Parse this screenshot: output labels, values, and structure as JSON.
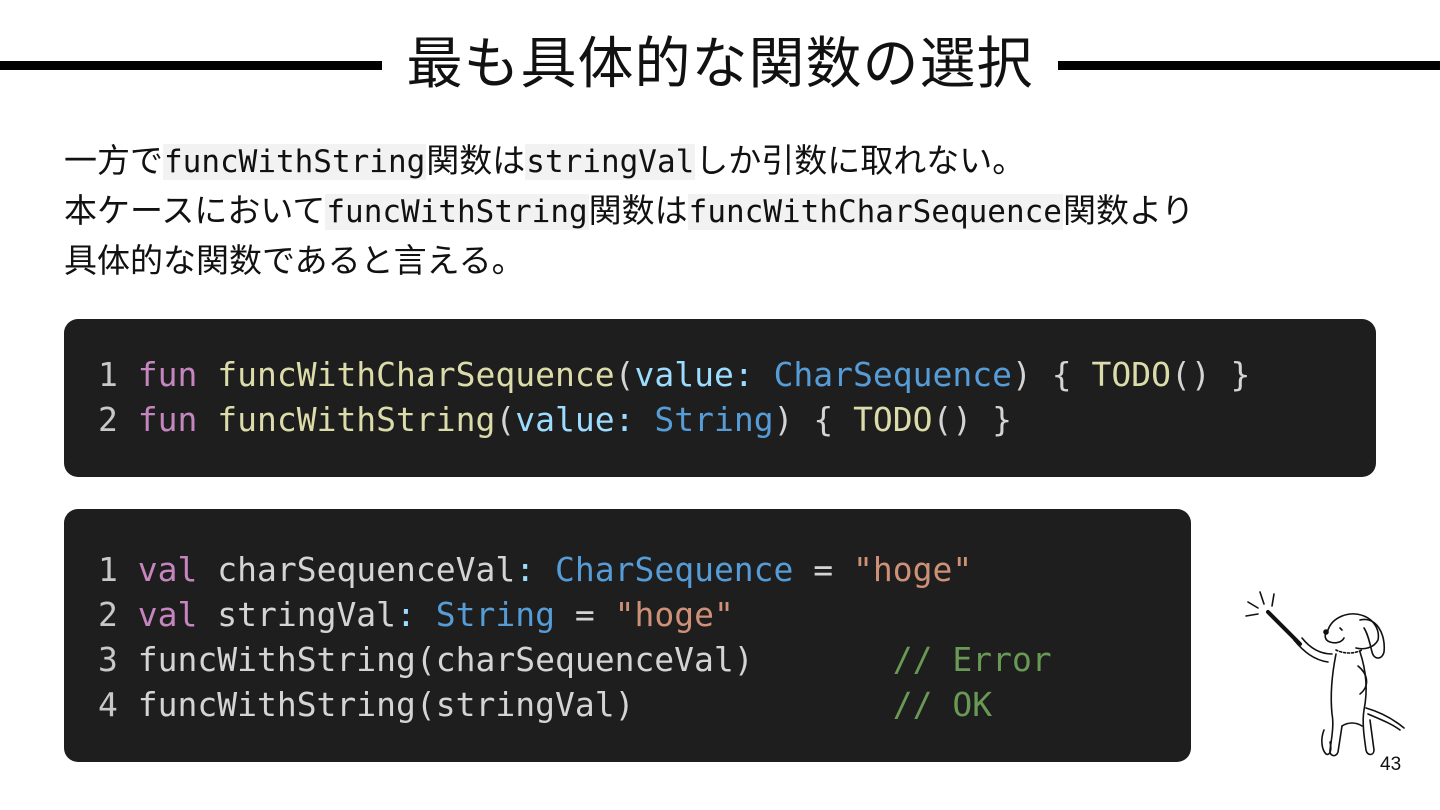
{
  "slide": {
    "title": "最も具体的な関数の選択",
    "page_number": "43"
  },
  "body": {
    "line1": {
      "t1": "一方で",
      "c1": "funcWithString",
      "t2": "関数は",
      "c2": "stringVal",
      "t3": "しか引数に取れない。"
    },
    "line2": {
      "t1": "本ケースにおいて",
      "c1": "funcWithString",
      "t2": "関数は",
      "c2": "funcWithCharSequence",
      "t3": "関数より"
    },
    "line3": {
      "t1": "具体的な関数であると言える。"
    }
  },
  "code1": {
    "lines": [
      {
        "num": "1",
        "kw": "fun",
        "fn": "funcWithCharSequence",
        "open": "(",
        "param": "value",
        "colon": ":",
        "type": "CharSequence",
        "rest": ") { ",
        "todo": "TODO",
        "end": "() }"
      },
      {
        "num": "2",
        "kw": "fun",
        "fn": "funcWithString",
        "open": "(",
        "param": "value",
        "colon": ":",
        "type": "String",
        "rest": ") { ",
        "todo": "TODO",
        "end": "() }"
      }
    ]
  },
  "code2": {
    "lines": [
      {
        "num": "1",
        "kw": "val",
        "name": "charSequenceVal",
        "colon": ":",
        "type": "CharSequence",
        "eq": " = ",
        "str": "\"hoge\""
      },
      {
        "num": "2",
        "kw": "val",
        "name": "stringVal",
        "colon": ":",
        "type": "String",
        "eq": " = ",
        "str": "\"hoge\""
      },
      {
        "num": "3",
        "call": "funcWithString(charSequenceVal)",
        "comment": "// Error"
      },
      {
        "num": "4",
        "call": "funcWithString(stringVal)",
        "comment": "// OK"
      }
    ]
  },
  "illustration": {
    "icon": "dog-with-wand-illustration"
  }
}
